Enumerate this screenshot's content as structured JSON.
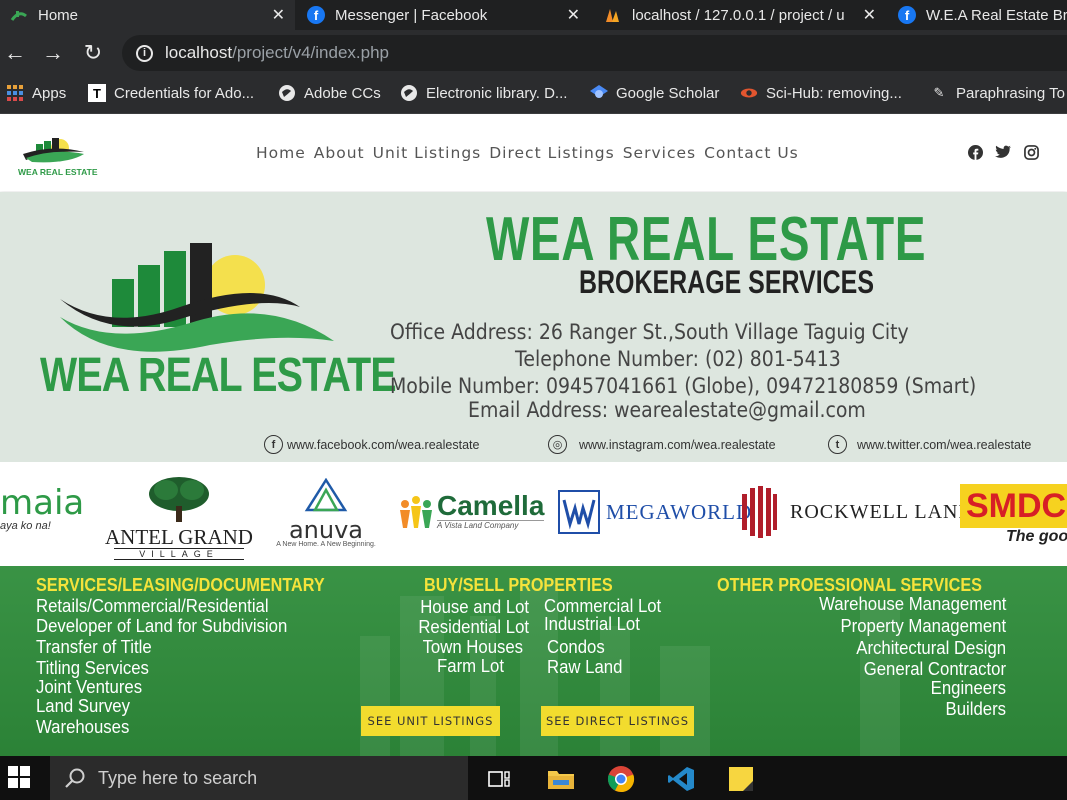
{
  "browser": {
    "tabs": [
      {
        "title": "Home",
        "icon": "home-leaf-icon",
        "active": true
      },
      {
        "title": "Messenger | Facebook",
        "icon": "facebook-icon"
      },
      {
        "title": "localhost / 127.0.0.1 / project / u",
        "icon": "phpmyadmin-icon"
      },
      {
        "title": "W.E.A Real Estate Bro",
        "icon": "facebook-icon"
      }
    ],
    "url_host": "localhost",
    "url_path": "/project/v4/index.php",
    "bookmarks": [
      {
        "label": "Apps",
        "icon": "apps-grid-icon"
      },
      {
        "label": "Credentials for Ado...",
        "icon": "t-icon"
      },
      {
        "label": "Adobe CCs",
        "icon": "globe-icon"
      },
      {
        "label": "Electronic library. D...",
        "icon": "globe-icon"
      },
      {
        "label": "Google Scholar",
        "icon": "scholar-icon"
      },
      {
        "label": "Sci-Hub: removing...",
        "icon": "eye-icon"
      },
      {
        "label": "Paraphrasing To",
        "icon": "pen-icon"
      }
    ]
  },
  "site": {
    "logo_text": "WEA REAL ESTATE",
    "nav": [
      "Home",
      "About",
      "Unit Listings",
      "Direct Listings",
      "Services",
      "Contact Us"
    ],
    "socials": [
      "facebook-icon",
      "twitter-icon",
      "instagram-icon"
    ]
  },
  "hero": {
    "logo_text": "WEA REAL ESTATE",
    "title": "WEA REAL ESTATE",
    "subtitle": "BROKERAGE SERVICES",
    "office": "Office Address: 26 Ranger St.,South Village Taguig City",
    "telephone": "Telephone Number: (02) 801-5413",
    "mobile": "Mobile Number: 09457041661 (Globe), 09472180859 (Smart)",
    "email": "Email Address: wearealestate@gmail.com",
    "facebook": "www.facebook.com/wea.realestate",
    "instagram": "www.instagram.com/wea.realestate",
    "twitter": "www.twitter.com/wea.realestate"
  },
  "partners": {
    "maia": "maia",
    "maia_tag": "aya ko na!",
    "antel": "ANTEL GRAND",
    "antel_sub": "VILLAGE",
    "anuva": "anuva",
    "anuva_tag": "A New Home. A New Beginning.",
    "camella": "Camella",
    "camella_tag": "A Vista Land Company",
    "megaworld": "MEGAWORLD",
    "rockwell": "ROCKWELL LAND",
    "smdc": "SMDC",
    "smdc_tag": "The goo"
  },
  "services": {
    "col1_title": "SERVICES/LEASING/DOCUMENTARY",
    "col1_items": [
      "Retails/Commercial/Residential",
      "Developer of Land for Subdivision",
      "Transfer of Title",
      "Titling Services",
      "Joint Ventures",
      "Land Survey",
      "Warehouses"
    ],
    "col2_title": "BUY/SELL PROPERTIES",
    "col2a_items": [
      "House and Lot",
      "Residential Lot",
      "Town Houses",
      "Farm Lot"
    ],
    "col2b_items": [
      "Commercial Lot",
      "Industrial Lot",
      "Condos",
      "Raw Land"
    ],
    "col3_title": "OTHER PROESSIONAL SERVICES",
    "col3_items": [
      "Warehouse Management",
      "Property Management",
      "Architectural Design",
      "General Contractor",
      "Engineers",
      "Builders"
    ],
    "btn_unit": "SEE UNIT LISTINGS",
    "btn_direct": "SEE DIRECT LISTINGS"
  },
  "taskbar": {
    "search_placeholder": "Type here to search",
    "apps": [
      "task-view-icon",
      "file-explorer-icon",
      "chrome-icon",
      "vscode-icon",
      "sticky-notes-icon"
    ]
  },
  "colors": {
    "brand_green": "#2e9a47",
    "services_bg": "#2f8d3b",
    "heading_yellow": "#f5e33b",
    "button_yellow": "#f2dc2e"
  }
}
